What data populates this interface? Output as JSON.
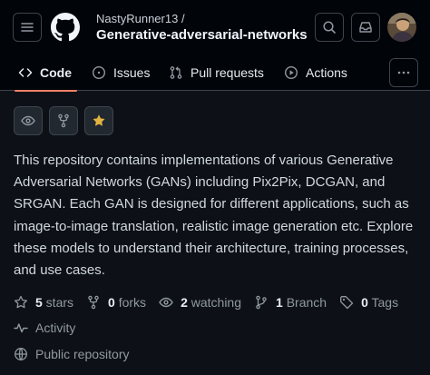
{
  "header": {
    "owner": "NastyRunner13 /",
    "repo_name": "Generative-adversarial-networks",
    "icons": [
      "hamburger-menu-icon",
      "github-logo-icon",
      "search-icon",
      "inbox-icon",
      "user-avatar"
    ]
  },
  "tabs": [
    {
      "label": "Code",
      "icon": "code-icon",
      "selected": true
    },
    {
      "label": "Issues",
      "icon": "issue-opened-icon"
    },
    {
      "label": "Pull requests",
      "icon": "pull-request-icon"
    },
    {
      "label": "Actions",
      "icon": "play-icon"
    }
  ],
  "buttons": {
    "watch": "eye-icon",
    "fork": "repo-forked-icon",
    "star": "star-fill-icon"
  },
  "description": "This repository contains implementations of various Generative Adversarial Networks (GANs) including Pix2Pix, DCGAN, and SRGAN. Each GAN is designed for different applications, such as image-to-image translation, realistic image generation etc. Explore these models to understand their architecture, training processes, and use cases.",
  "stats": {
    "stars_count": "5",
    "stars_label": " stars",
    "forks_count": "0",
    "forks_label": " forks",
    "watching_count": "2",
    "watching_label": " watching",
    "branch_count": "1",
    "branch_label": " Branch",
    "tags_count": "0",
    "tags_label": " Tags",
    "activity": "Activity",
    "visibility": "Public repository"
  },
  "colors": {
    "background": "#0d1117",
    "header": "#010409",
    "selected_underline": "#f78166",
    "star": "#e3b341",
    "muted": "#9198a1"
  }
}
